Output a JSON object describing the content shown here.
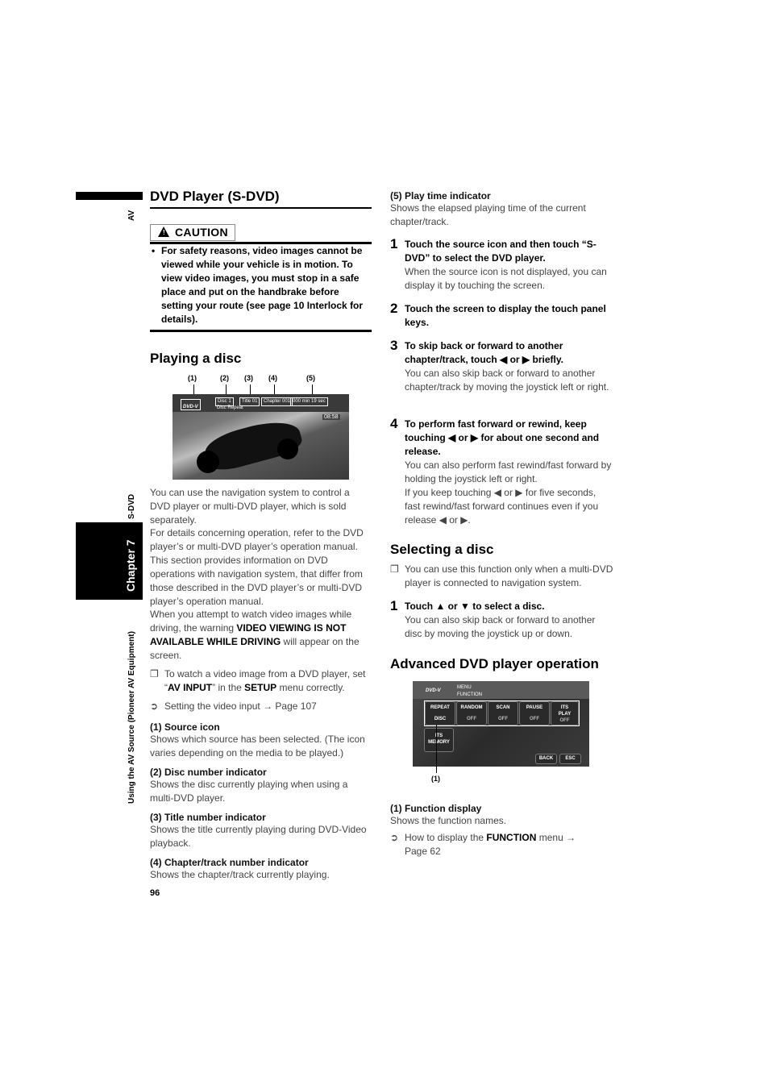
{
  "margin": {
    "section_tab": "AV",
    "section_label": "S-DVD",
    "chapter_label": "Chapter 7",
    "chapter_title": "Using the AV Source (Pioneer AV Equipment)",
    "page_number": "96"
  },
  "left": {
    "title": "DVD Player (S-DVD)",
    "caution_label": "CAUTION",
    "caution_text": "For safety reasons, video images cannot be viewed while your vehicle is in motion. To view video images, you must stop in a safe place and put on the handbrake before setting your route (see page 10 Interlock for details).",
    "playing_heading": "Playing a disc",
    "callouts": [
      "(1)",
      "(2)",
      "(3)",
      "(4)",
      "(5)"
    ],
    "screen": {
      "source": "DVD-V",
      "disc": "Disc 1",
      "title": "Title 01",
      "chapter": "Chapter 001",
      "time": "000 min 19 sec",
      "repeat": "Disc Repeat",
      "clock": "08:58"
    },
    "intro_p1": "You can use the navigation system to control a DVD player or multi-DVD player, which is sold separately.",
    "intro_p2": "For details concerning operation, refer to the DVD player’s or multi-DVD player’s operation manual. This section provides information on DVD operations with navigation system, that differ from those described in the DVD player’s or multi-DVD player’s operation manual.",
    "intro_p3_a": "When you attempt to watch video images while driving, the warning ",
    "intro_p3_b": "VIDEO VIEWING IS NOT AVAILABLE WHILE DRIVING",
    "intro_p3_c": " will appear on the screen.",
    "note_a": "To watch a video image from a DVD player, set “",
    "note_b": "AV INPUT",
    "note_c": "” in the ",
    "note_d": "SETUP",
    "note_e": " menu correctly.",
    "ref_text": "Setting the video input → Page 107",
    "items": [
      {
        "head": "(1) Source icon",
        "text": "Shows which source has been selected. (The icon varies depending on the media to be played.)"
      },
      {
        "head": "(2) Disc number indicator",
        "text": "Shows the disc currently playing when using a multi-DVD player."
      },
      {
        "head": "(3) Title number indicator",
        "text": "Shows the title currently playing during DVD-Video playback."
      },
      {
        "head": "(4) Chapter/track number indicator",
        "text": "Shows the chapter/track currently playing."
      }
    ]
  },
  "right": {
    "item5": {
      "head": "(5) Play time indicator",
      "text": "Shows the elapsed playing time of the current chapter/track."
    },
    "steps": [
      {
        "num": "1",
        "title": "Touch the source icon and then touch “S-DVD” to select the DVD player.",
        "text": "When the source icon is not displayed, you can display it by touching the screen."
      },
      {
        "num": "2",
        "title": "Touch the screen to display the touch panel keys.",
        "text": ""
      },
      {
        "num": "3",
        "title": "To skip back or forward to another chapter/track, touch ◀ or ▶ briefly.",
        "text": "You can also skip back or forward to another chapter/track by moving the joystick left or right."
      },
      {
        "num": "4",
        "title": "To perform fast forward or rewind, keep touching ◀ or ▶ for about one second and release.",
        "text": "You can also perform fast rewind/fast forward by holding the joystick left or right.",
        "text2": "If you keep touching ◀ or ▶ for five seconds, fast rewind/fast forward continues even if you release ◀ or ▶."
      }
    ],
    "selecting_heading": "Selecting a disc",
    "selecting_note": "You can use this function only when a multi-DVD player is connected to navigation system.",
    "selecting_step": {
      "num": "1",
      "title": "Touch ▲ or ▼ to select a disc.",
      "text": "You can also skip back or forward to another disc by moving the joystick up or down."
    },
    "advanced_heading": "Advanced DVD player operation",
    "menu_screen": {
      "source": "DVD-V",
      "menu": "MENU",
      "function": "FUNCTION",
      "buttons": [
        {
          "label": "REPEAT",
          "value": "DISC"
        },
        {
          "label": "RANDOM",
          "value": "OFF"
        },
        {
          "label": "SCAN",
          "value": "OFF"
        },
        {
          "label": "PAUSE",
          "value": "OFF"
        },
        {
          "label": "ITS PLAY",
          "value": "OFF"
        }
      ],
      "its_memory": "ITS MEMORY",
      "back": "BACK",
      "esc": "ESC",
      "callout": "(1)"
    },
    "item_func": {
      "head": "(1) Function display",
      "text": "Shows the function names."
    },
    "ref_a": "How to display the ",
    "ref_b": "FUNCTION",
    "ref_c": " menu → Page 62"
  }
}
